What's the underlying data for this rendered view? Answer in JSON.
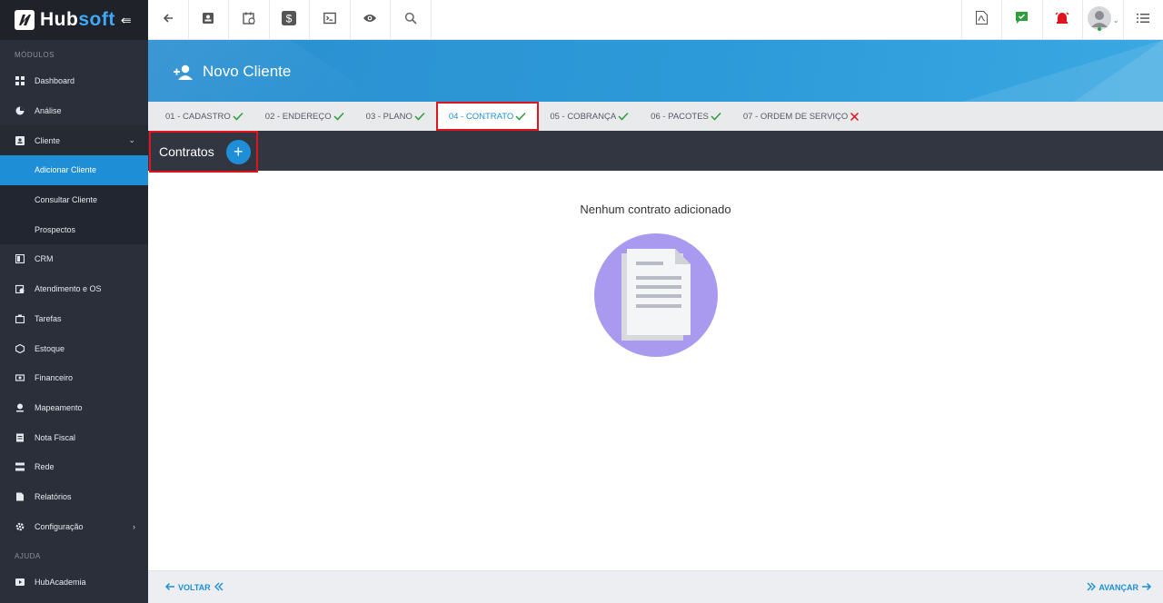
{
  "brand": {
    "name_part1": "Hub",
    "name_part2": "soft",
    "icon": "hubsoft-logo-icon"
  },
  "sidebar": {
    "section_modules": "MÓDULOS",
    "section_help": "AJUDA",
    "items": [
      {
        "label": "Dashboard",
        "icon": "grid-icon"
      },
      {
        "label": "Análise",
        "icon": "pie-chart-icon"
      },
      {
        "label": "Cliente",
        "icon": "contact-card-icon"
      },
      {
        "label": "CRM",
        "icon": "crm-board-icon"
      },
      {
        "label": "Atendimento e OS",
        "icon": "calendar-clock-icon"
      },
      {
        "label": "Tarefas",
        "icon": "tasks-icon"
      },
      {
        "label": "Estoque",
        "icon": "box-icon"
      },
      {
        "label": "Financeiro",
        "icon": "money-icon"
      },
      {
        "label": "Mapeamento",
        "icon": "map-pin-icon"
      },
      {
        "label": "Nota Fiscal",
        "icon": "receipt-icon"
      },
      {
        "label": "Rede",
        "icon": "network-icon"
      },
      {
        "label": "Relatórios",
        "icon": "report-icon"
      },
      {
        "label": "Configuração",
        "icon": "gear-icon"
      },
      {
        "label": "HubAcademia",
        "icon": "play-icon"
      }
    ],
    "cliente_sub": [
      "Adicionar Cliente",
      "Consultar Cliente",
      "Prospectos"
    ]
  },
  "topbar": {
    "icons": [
      "back-arrow-icon",
      "contact-card-icon",
      "calendar-clock-icon",
      "dollar-icon",
      "terminal-icon",
      "eye-icon",
      "search-icon"
    ],
    "right_icons": [
      "pdf-icon",
      "chat-check-icon",
      "alarm-bell-icon",
      "avatar",
      "menu-list-icon"
    ]
  },
  "header": {
    "title": "Novo Cliente"
  },
  "steps": [
    {
      "label": "01 - CADASTRO",
      "status": "ok"
    },
    {
      "label": "02 - ENDEREÇO",
      "status": "ok"
    },
    {
      "label": "03 - PLANO",
      "status": "ok"
    },
    {
      "label": "04 - CONTRATO",
      "status": "ok"
    },
    {
      "label": "05 - COBRANÇA",
      "status": "ok"
    },
    {
      "label": "06 - PACOTES",
      "status": "ok"
    },
    {
      "label": "07 - ORDEM DE SERVIÇO",
      "status": "error"
    }
  ],
  "section": {
    "title": "Contratos",
    "add_label": "+"
  },
  "empty": {
    "message": "Nenhum contrato adicionado"
  },
  "footer": {
    "back_label": "VOLTAR",
    "next_label": "AVANÇAR"
  },
  "colors": {
    "accent": "#1e8fd6",
    "sidebar_bg": "#2b2f3a",
    "ok": "#2e9d3d",
    "error": "#e0141c",
    "highlight": "#e0141c"
  }
}
